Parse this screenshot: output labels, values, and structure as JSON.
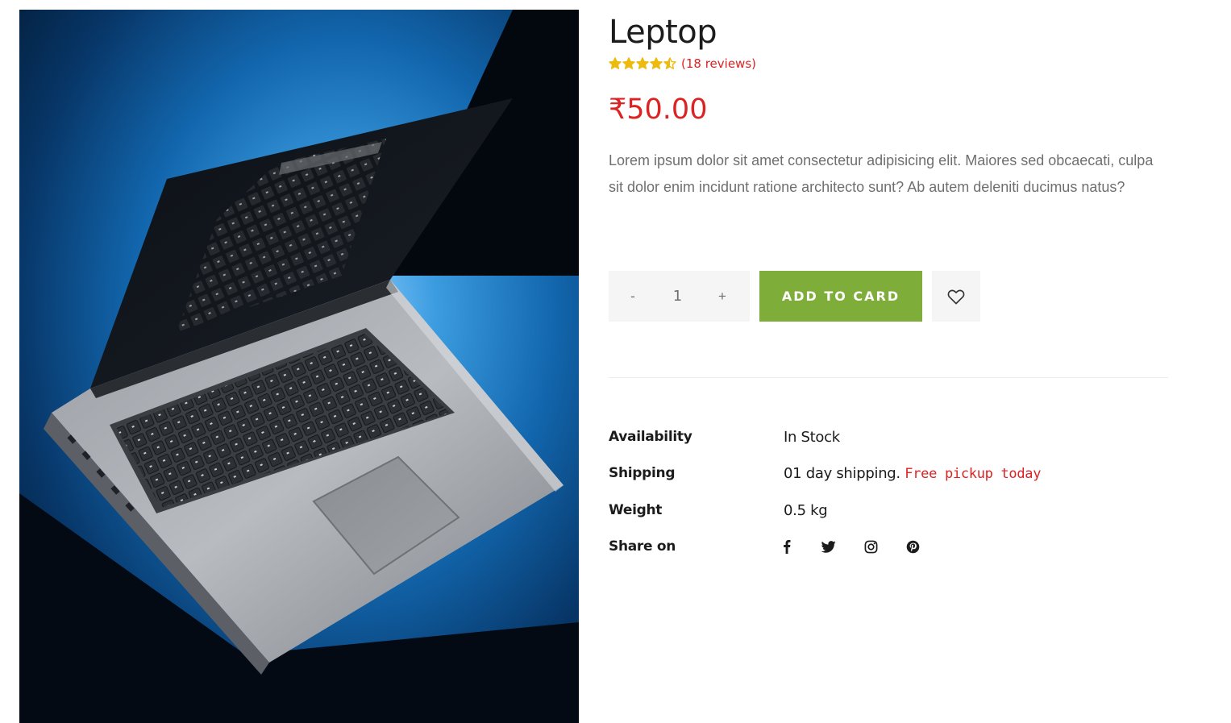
{
  "product": {
    "title": "Leptop",
    "rating": 4.5,
    "rating_max": 5,
    "review_count_text": "(18 reviews)",
    "price": "₹50.00",
    "description": "Lorem ipsum dolor sit amet consectetur adipisicing elit. Maiores sed obcaecati, culpa sit dolor enim incidunt ratione architecto sunt? Ab autem deleniti ducimus natus?",
    "image_icon": "laptop-photo"
  },
  "cart": {
    "minus_label": "-",
    "quantity": "1",
    "plus_label": "+",
    "add_button_label": "ADD TO CARD",
    "wishlist_icon": "heart-icon"
  },
  "info": {
    "availability_label": "Availability",
    "availability_value": "In Stock",
    "shipping_label": "Shipping",
    "shipping_value": "01 day shipping.",
    "shipping_highlight": "Free pickup today",
    "weight_label": "Weight",
    "weight_value": "0.5 kg",
    "share_label": "Share on",
    "share_icons": [
      "facebook-icon",
      "twitter-icon",
      "instagram-icon",
      "pinterest-icon"
    ]
  },
  "colors": {
    "accent_red": "#dd2222",
    "button_green": "#7fad39",
    "star_gold": "#edbb0e",
    "muted_bg": "#f5f5f5"
  }
}
